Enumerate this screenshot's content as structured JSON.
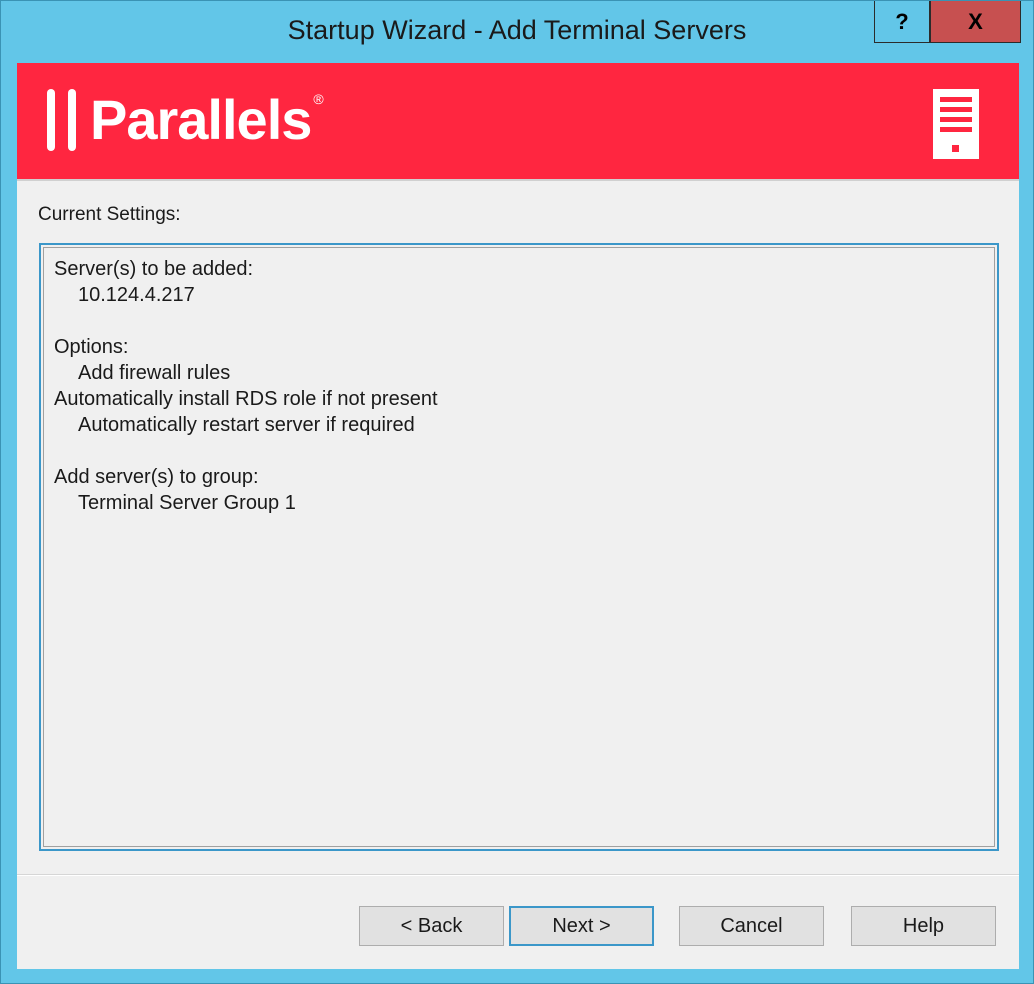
{
  "window": {
    "title": "Startup Wizard - Add Terminal Servers",
    "help_button": "?",
    "close_button": "X"
  },
  "banner": {
    "logo_text": "Parallels",
    "logo_mark": "®",
    "icon": "server-icon",
    "background_color": "#ff2640"
  },
  "main": {
    "current_settings_label": "Current Settings:",
    "settings_lines": [
      {
        "text": "Server(s) to be added:",
        "indent": false
      },
      {
        "text": "10.124.4.217",
        "indent": true
      },
      {
        "text": "",
        "indent": false
      },
      {
        "text": "Options:",
        "indent": false
      },
      {
        "text": "Add firewall rules",
        "indent": true
      },
      {
        "text": "Automatically install RDS role if not present",
        "indent": false
      },
      {
        "text": "Automatically restart server if required",
        "indent": true
      },
      {
        "text": "",
        "indent": false
      },
      {
        "text": "Add server(s) to group:",
        "indent": false
      },
      {
        "text": "Terminal Server Group 1",
        "indent": true
      }
    ]
  },
  "footer": {
    "back_label": "< Back",
    "next_label": "Next >",
    "cancel_label": "Cancel",
    "help_label": "Help"
  }
}
